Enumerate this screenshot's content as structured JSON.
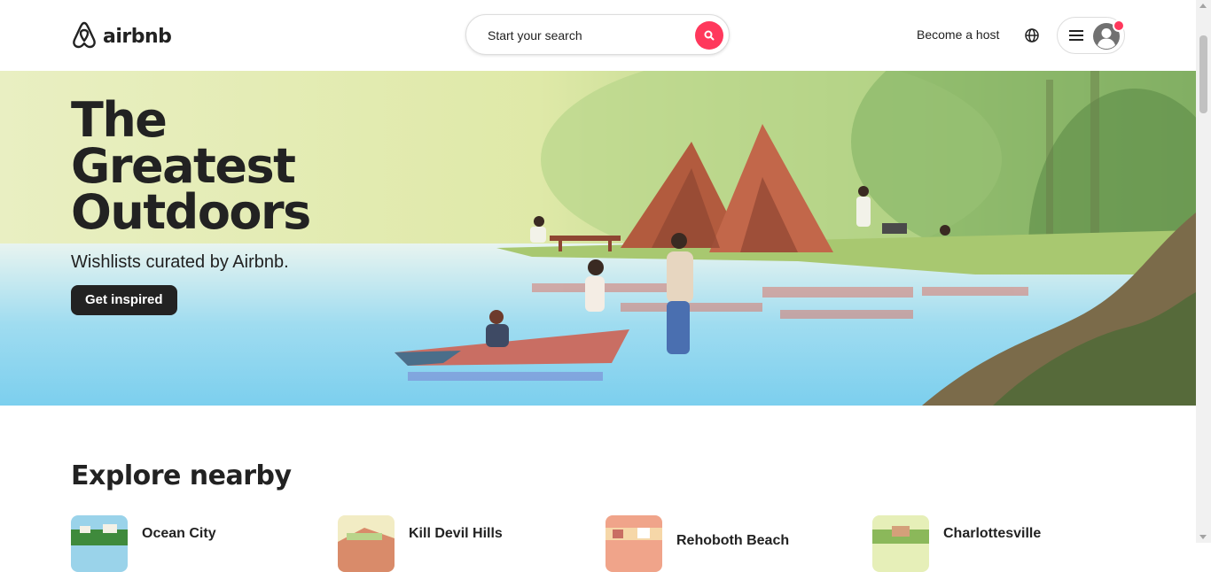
{
  "header": {
    "logo_text": "airbnb",
    "search_placeholder": "Start your search",
    "host_label": "Become a host"
  },
  "hero": {
    "title": "The\nGreatest\nOutdoors",
    "subtitle": "Wishlists curated by Airbnb.",
    "button_label": "Get inspired"
  },
  "explore": {
    "title": "Explore nearby",
    "places": [
      {
        "name": "Ocean City"
      },
      {
        "name": "Kill Devil Hills"
      },
      {
        "name": "Rehoboth Beach"
      },
      {
        "name": "Charlottesville"
      }
    ]
  },
  "colors": {
    "brand": "#ff385c",
    "text": "#222222",
    "button_dark": "#222222"
  },
  "icons": [
    "airbnb-logo-icon",
    "search-icon",
    "globe-icon",
    "menu-icon",
    "user-avatar-icon"
  ]
}
